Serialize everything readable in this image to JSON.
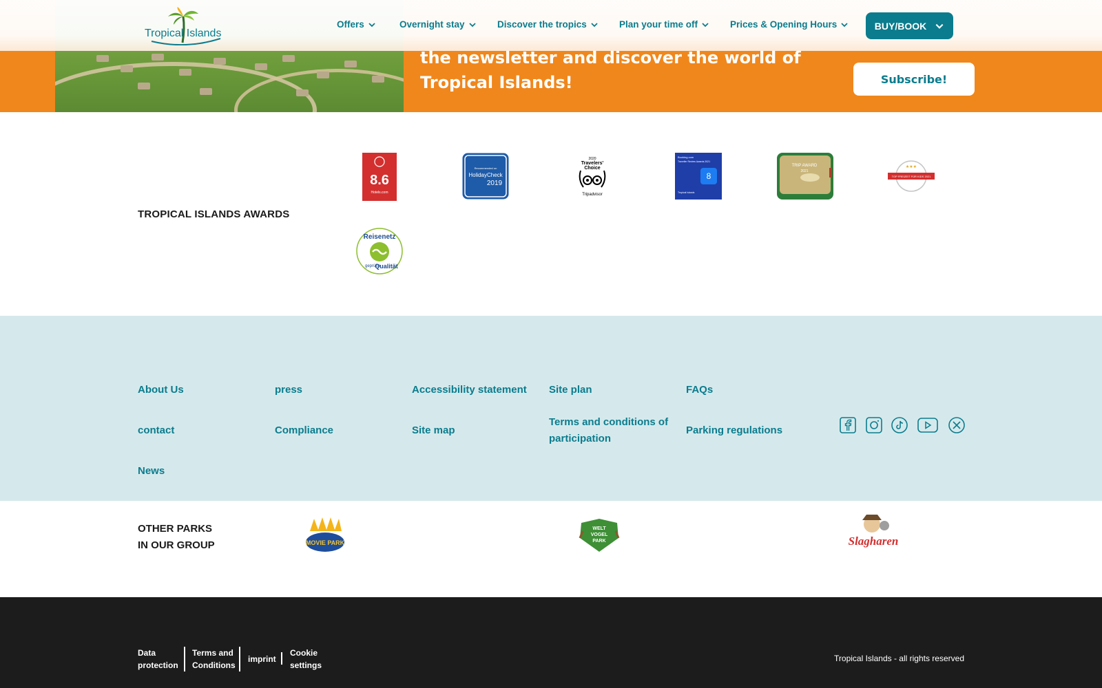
{
  "header": {
    "logo_text": "Tropical Islands",
    "nav": [
      {
        "label": "Offers"
      },
      {
        "label": "Overnight stay"
      },
      {
        "label": "Discover the tropics"
      },
      {
        "label": "Plan your time off"
      },
      {
        "label": "Prices & Opening Hours"
      }
    ],
    "buy_label": "BUY/BOOK"
  },
  "newsletter": {
    "text": "the newsletter and discover the world of Tropical Islands!",
    "subscribe_label": "Subscribe!"
  },
  "awards": {
    "title": "TROPICAL ISLANDS AWARDS",
    "hotels_score": "8.6",
    "hotels_brand": "Hotels.com",
    "holidaycheck_small": "Recommended on",
    "holidaycheck_name": "HolidayCheck",
    "holidaycheck_year": "2019",
    "tripadvisor_year": "2020",
    "tripadvisor_line1": "Travelers'",
    "tripadvisor_line2": "Choice",
    "tripadvisor_brand": "Tripadvisor",
    "booking_header": "Booking.com",
    "booking_sub": "Traveller Review Awards 2021",
    "booking_score": "8",
    "booking_footer": "Tropical Islands",
    "gold_line1": "TRIP AWARD",
    "gold_line2": "2021",
    "familien_text": "TOP FREIZEIT FÜR KIDS 2021",
    "reisenetz_top": "Reisenetz",
    "reisenetz_bottom1": "geprüfte",
    "reisenetz_bottom2": "Qualität"
  },
  "footer_links": {
    "about": "About Us",
    "press": "press",
    "accessibility": "Accessibility statement",
    "site_plan": "Site plan",
    "faqs": "FAQs",
    "contact": "contact",
    "compliance": "Compliance",
    "site_map": "Site map",
    "terms_line1": "Terms and conditions of",
    "terms_line2": "participation",
    "parking": "Parking regulations",
    "news": "News"
  },
  "social": [
    "facebook-icon",
    "instagram-icon",
    "tiktok-icon",
    "youtube-icon",
    "x-icon"
  ],
  "parks": {
    "title_line1": "OTHER PARKS",
    "title_line2": "IN OUR GROUP",
    "movie_park": "MOVIE PARK",
    "vogelpark_line1": "WELT",
    "vogelpark_line2": "VOGEL",
    "vogelpark_line3": "PARK",
    "slagharen": "Slagharen"
  },
  "bottom": {
    "data_protection_1": "Data",
    "data_protection_2": "protection",
    "terms_1": "Terms and",
    "terms_2": "Conditions",
    "imprint": "imprint",
    "cookie_1": "Cookie",
    "cookie_2": "settings",
    "copyright": "Tropical Islands - all rights reserved"
  },
  "colors": {
    "brand_teal": "#0b7c8d",
    "newsletter_orange": "#f0871c",
    "footer_light": "#d5e9ec",
    "bottom_dark": "#1c1c1c"
  }
}
